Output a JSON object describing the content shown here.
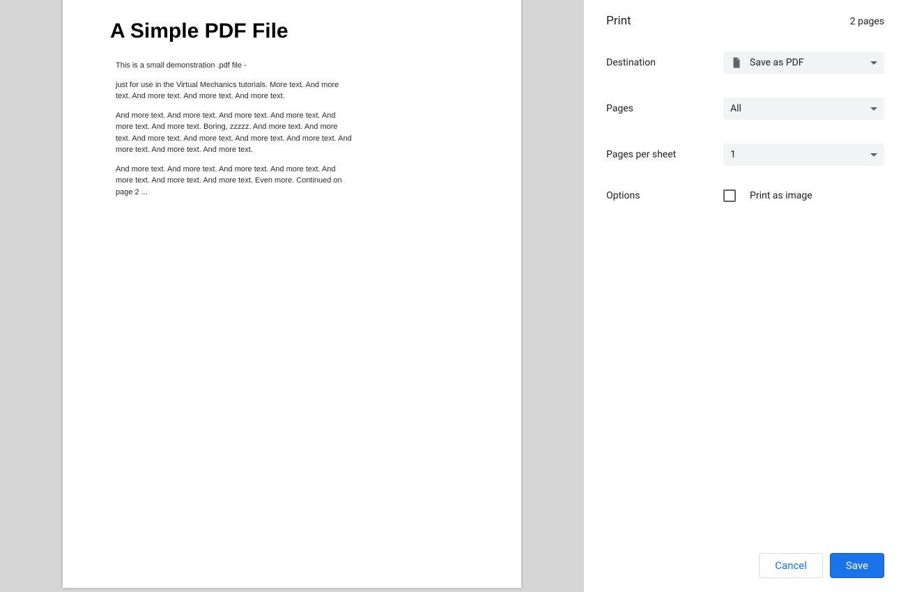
{
  "sidebar": {
    "title": "Print",
    "page_count": "2 pages",
    "destination": {
      "label": "Destination",
      "value": "Save as PDF"
    },
    "pages": {
      "label": "Pages",
      "value": "All"
    },
    "pages_per_sheet": {
      "label": "Pages per sheet",
      "value": "1"
    },
    "options": {
      "label": "Options",
      "checkbox_label": "Print as image",
      "checked": false
    },
    "buttons": {
      "cancel": "Cancel",
      "save": "Save"
    }
  },
  "document": {
    "title": "A Simple PDF File",
    "paragraphs": [
      "This is a small demonstration .pdf file -",
      "just for use in the Virtual Mechanics tutorials. More text. And more text. And more text. And more text. And more text.",
      "And more text. And more text. And more text. And more text. And more text. And more text. Boring, zzzzz. And more text. And more text. And more text. And more text. And more text. And more text. And more text. And more text. And more text.",
      "And more text. And more text. And more text. And more text. And more text. And more text. And more text. Even more. Continued on page 2 ..."
    ]
  }
}
